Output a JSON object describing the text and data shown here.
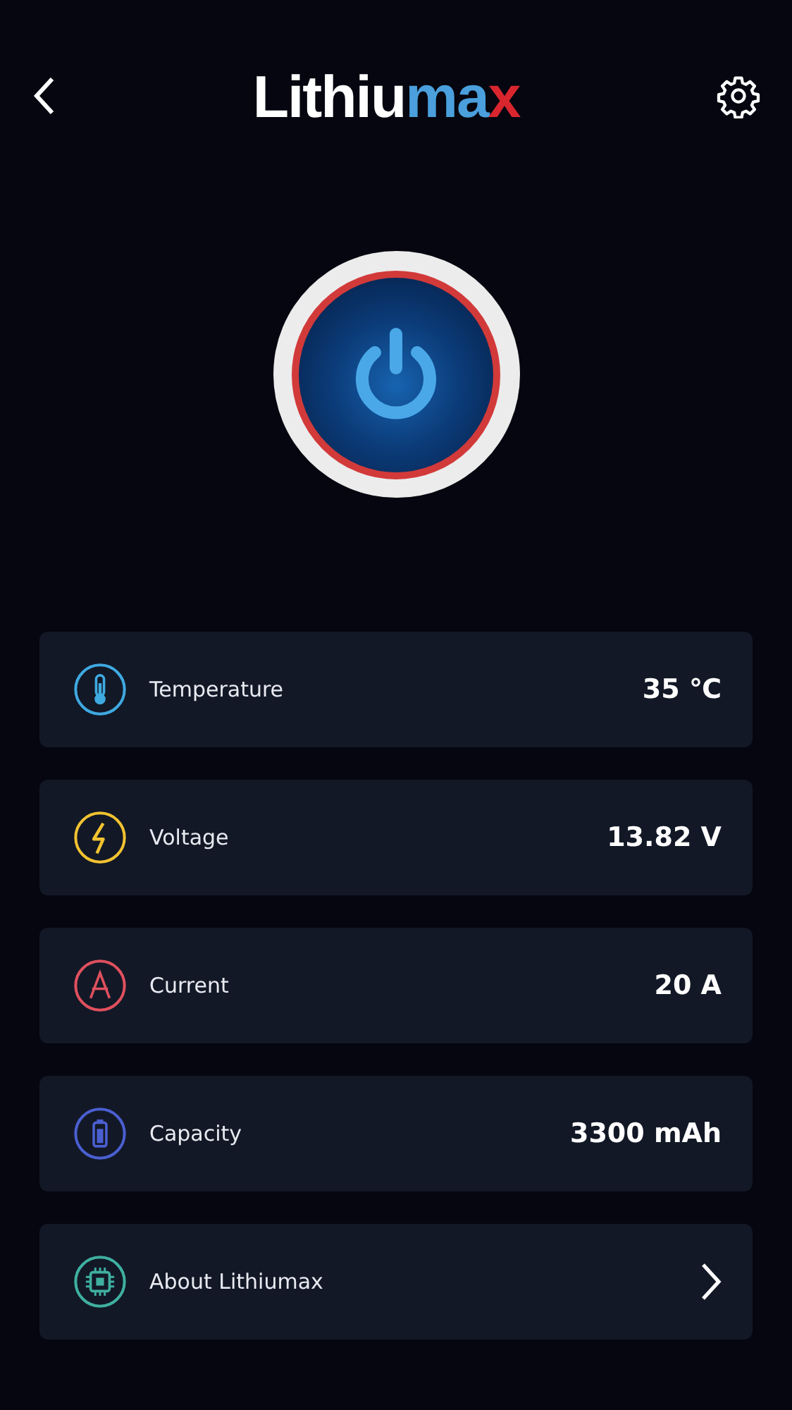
{
  "header": {
    "logo": [
      {
        "text": "Lithiu",
        "color": "#ffffff"
      },
      {
        "text": "ma",
        "color": "#4a9fdc"
      },
      {
        "text": "x",
        "color": "#d9262e"
      }
    ]
  },
  "power": {
    "on": true
  },
  "rows": [
    {
      "kind": "reading",
      "label": "Temperature",
      "value": "35 ℃",
      "color": "#3fa9e0"
    },
    {
      "kind": "reading",
      "label": "Voltage",
      "value": "13.82 V",
      "color": "#f2c230"
    },
    {
      "kind": "reading",
      "label": "Current",
      "value": "20 A",
      "color": "#e0505e"
    },
    {
      "kind": "reading",
      "label": "Capacity",
      "value": "3300 mAh",
      "color": "#4a5fd0"
    },
    {
      "kind": "link",
      "label": "About Lithiumax",
      "color": "#3fb0a0"
    }
  ]
}
